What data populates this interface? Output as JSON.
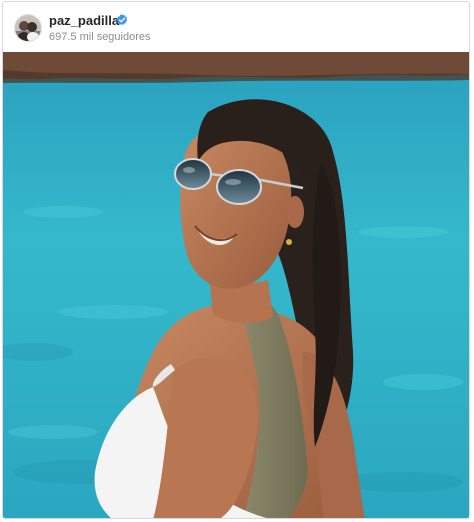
{
  "account": {
    "username": "paz_padilla",
    "verified": true,
    "followers_text": "697.5 mil seguidores"
  },
  "post": {
    "photo_icon": "photo"
  },
  "colors": {
    "verified_badge": "#3897f0",
    "username_text": "#262626",
    "secondary_text": "#8e8e8e",
    "sea": "#2fb3c8",
    "card_border": "#d8d8d8"
  }
}
